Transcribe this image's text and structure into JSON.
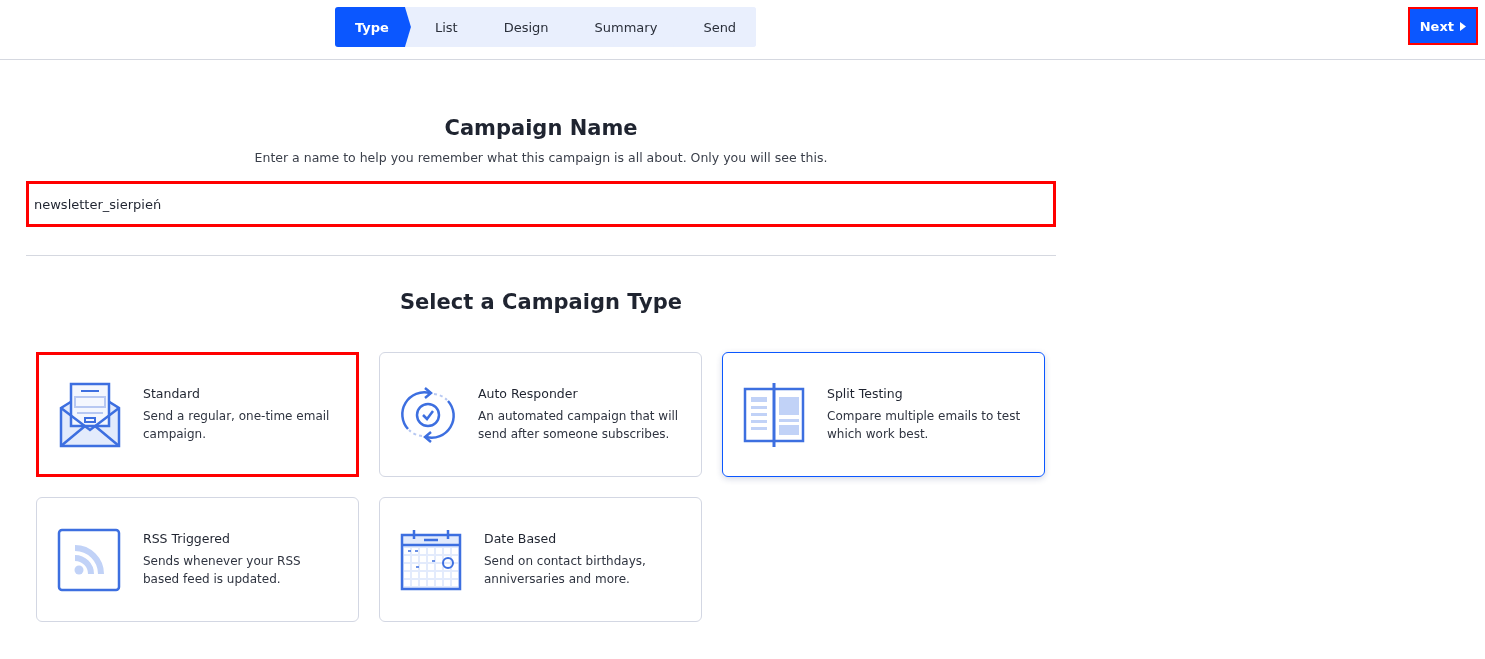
{
  "steps": [
    {
      "label": "Type",
      "selected": true
    },
    {
      "label": "List",
      "selected": false
    },
    {
      "label": "Design",
      "selected": false
    },
    {
      "label": "Summary",
      "selected": false
    },
    {
      "label": "Send",
      "selected": false
    }
  ],
  "next_button": {
    "label": "Next",
    "highlighted": true
  },
  "campaign_name": {
    "title": "Campaign Name",
    "hint": "Enter a name to help you remember what this campaign is all about. Only you will see this.",
    "value": "newsletter_sierpień",
    "highlighted": true
  },
  "campaign_type": {
    "title": "Select a Campaign Type",
    "cards": [
      {
        "kind": "standard",
        "title": "Standard",
        "description": "Send a regular, one-time email campaign.",
        "highlighted": true,
        "selected": false
      },
      {
        "kind": "autoresponder",
        "title": "Auto Responder",
        "description": "An automated campaign that will send after someone subscribes.",
        "highlighted": false,
        "selected": false
      },
      {
        "kind": "split",
        "title": "Split Testing",
        "description": "Compare multiple emails to test which work best.",
        "highlighted": false,
        "selected": true
      },
      {
        "kind": "rss",
        "title": "RSS Triggered",
        "description": "Sends whenever your RSS based feed is updated.",
        "highlighted": false,
        "selected": false
      },
      {
        "kind": "date",
        "title": "Date Based",
        "description": "Send on contact birthdays, anniversaries and more.",
        "highlighted": false,
        "selected": false
      }
    ]
  }
}
